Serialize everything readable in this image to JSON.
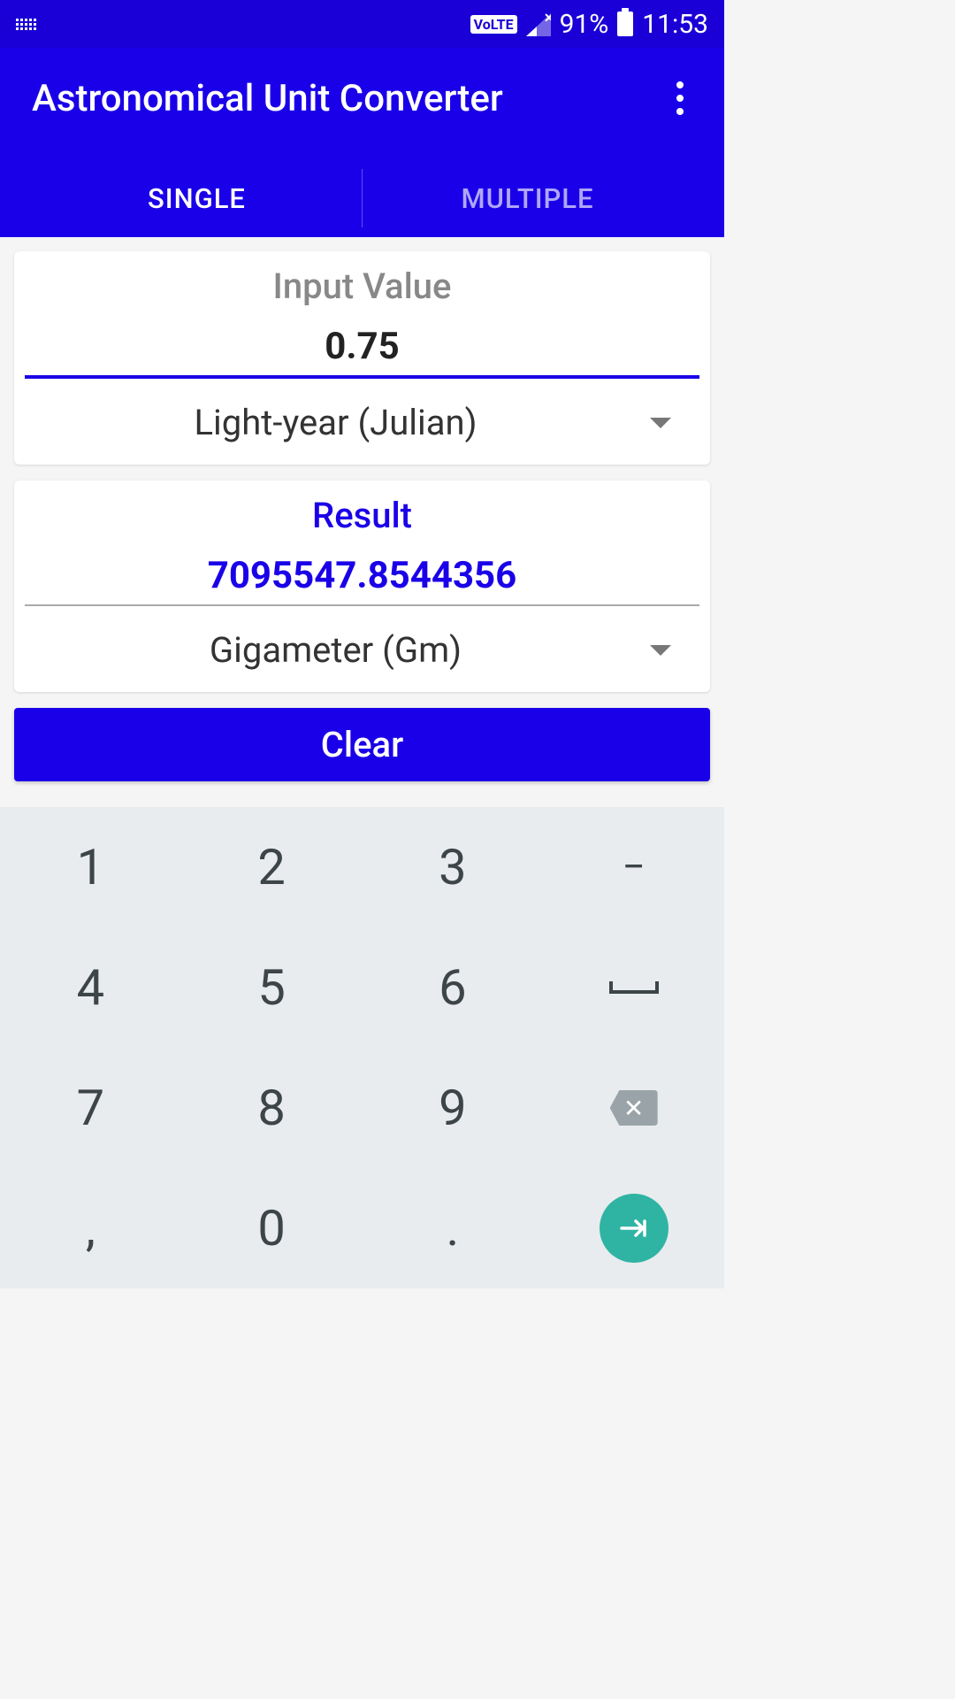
{
  "status": {
    "volte": "VoLTE",
    "battery_percent": "91%",
    "time": "11:53"
  },
  "header": {
    "title": "Astronomical Unit Converter"
  },
  "tabs": {
    "single": "SINGLE",
    "multiple": "MULTIPLE"
  },
  "input_card": {
    "label": "Input Value",
    "value": "0.75",
    "unit": "Light-year (Julian)"
  },
  "result_card": {
    "label": "Result",
    "value": "7095547.8544356",
    "unit": "Gigameter (Gm)"
  },
  "clear_button": "Clear",
  "keypad": {
    "k1": "1",
    "k2": "2",
    "k3": "3",
    "minus": "−",
    "k4": "4",
    "k5": "5",
    "k6": "6",
    "k7": "7",
    "k8": "8",
    "k9": "9",
    "backspace": "✕",
    "comma": ",",
    "k0": "0",
    "dot": "."
  }
}
